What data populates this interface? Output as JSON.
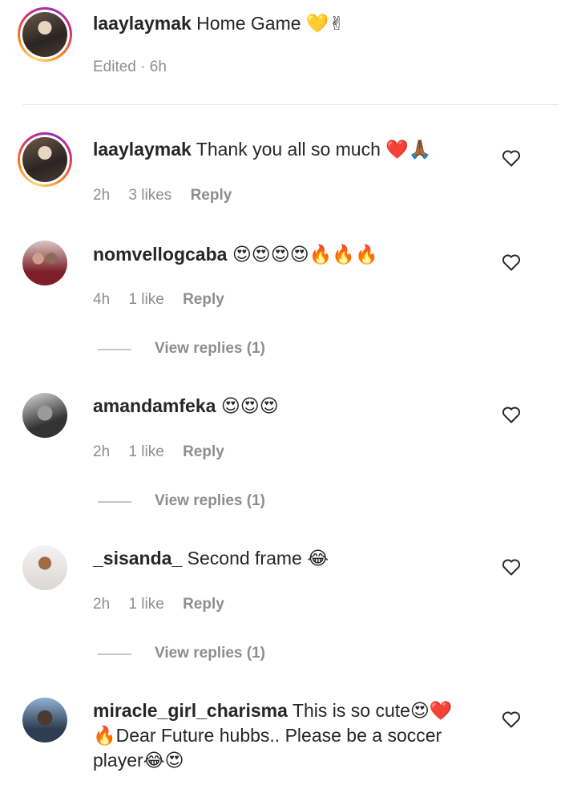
{
  "caption": {
    "username": "laaylaymak",
    "text": "Home Game 💛✌",
    "meta": "Edited · 6h"
  },
  "comments": [
    {
      "username": "laaylaymak",
      "text": "Thank you all so much ❤️🙏🏾",
      "time": "2h",
      "likes": "3 likes",
      "reply": "Reply"
    },
    {
      "username": "nomvellogcaba",
      "text": "😍😍😍😍🔥🔥🔥",
      "time": "4h",
      "likes": "1 like",
      "reply": "Reply",
      "view_replies": "View replies (1)"
    },
    {
      "username": "amandamfeka",
      "text": "😍😍😍",
      "time": "2h",
      "likes": "1 like",
      "reply": "Reply",
      "view_replies": "View replies (1)"
    },
    {
      "username": "_sisanda_",
      "text": "Second frame 😂",
      "time": "2h",
      "likes": "1 like",
      "reply": "Reply",
      "view_replies": "View replies (1)"
    },
    {
      "username": "miracle_girl_charisma",
      "text_line1": "This is so cute😍❤️",
      "text_line2": "🔥Dear Future hubbs.. Please be a soccer",
      "text_line3": "player😂😍"
    }
  ],
  "icons": {
    "like": "heart-outline-icon"
  },
  "colors": {
    "text": "#262626",
    "secondary": "#8e8e8e",
    "story_ring": "#d62976"
  }
}
